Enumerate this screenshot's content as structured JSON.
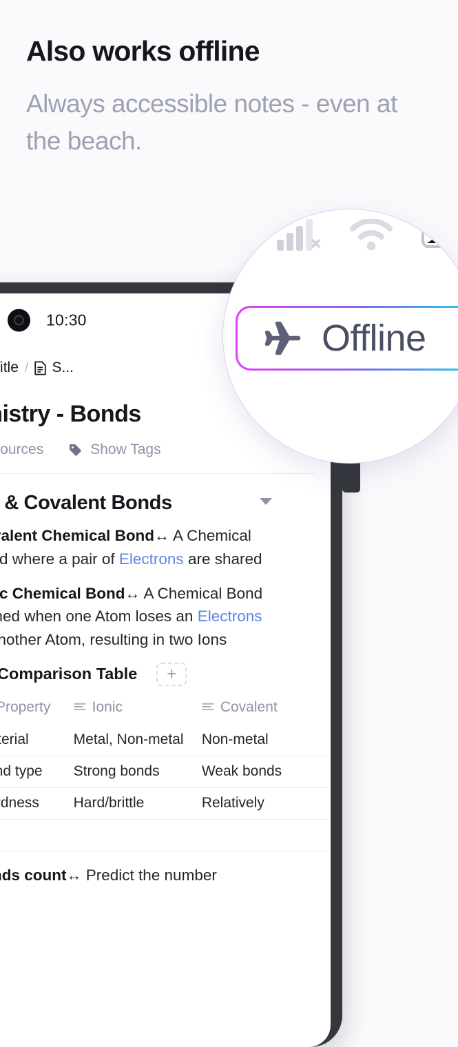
{
  "promo": {
    "headline": "Also works offline",
    "subheadline": "Always accessible notes - even at the beach."
  },
  "phone": {
    "status_bar": {
      "clock": "10:30",
      "icons": [
        "signal-off-icon",
        "wifi-icon",
        "battery-icon"
      ]
    },
    "toolbar": {
      "menu_icon": "hamburger-icon",
      "breadcrumb": [
        {
          "icon": "document-icon",
          "label": "Title"
        },
        {
          "icon": "document-icon",
          "label": "S..."
        }
      ],
      "separator": "/",
      "offline_chip_icon": "airplane-icon"
    },
    "note": {
      "title": "Chemistry -  Bonds",
      "actions": [
        {
          "icon": "link-icon",
          "label": "Add Sources"
        },
        {
          "icon": "tag-icon",
          "label": "Show Tags"
        }
      ],
      "section": {
        "title": "Ionic & Covalent Bonds",
        "collapse_icon": "chevron-down-icon",
        "bullets": [
          {
            "term": "Covalent Chemical Bond",
            "arrow": "↔",
            "before_link": " A Chemical Bond where a pair of ",
            "link": "Electrons",
            "after_link": " are shared"
          },
          {
            "term": "Ionic Chemical Bond",
            "arrow": "↔",
            "before_link": " A Chemical Bond formed when one Atom loses an ",
            "link": "Electrons",
            "after_link": " to another Atom, resulting in two Ions"
          }
        ],
        "table_block": {
          "icon": "table-icon",
          "title": "Comparison Table",
          "add_label": "+",
          "columns": [
            "Property",
            "Ionic",
            "Covalent"
          ],
          "rows": [
            [
              "Material",
              "Metal, Non-metal",
              "Non-metal"
            ],
            [
              "Bond type",
              "Strong bonds",
              "Weak bonds"
            ],
            [
              "Hardness",
              "Hard/brittle",
              "Relatively"
            ]
          ],
          "add_row_label": "+"
        },
        "tail_bullet": {
          "term": "Bonds count",
          "arrow": "↔",
          "text": " Predict the number"
        }
      }
    }
  },
  "magnifier": {
    "pill_label": "Offline",
    "pill_icon": "airplane-icon",
    "status_icons": [
      "signal-off-icon",
      "wifi-icon",
      "battery-icon"
    ],
    "gradient_start": "#e040fb",
    "gradient_end": "#22d3ee"
  }
}
